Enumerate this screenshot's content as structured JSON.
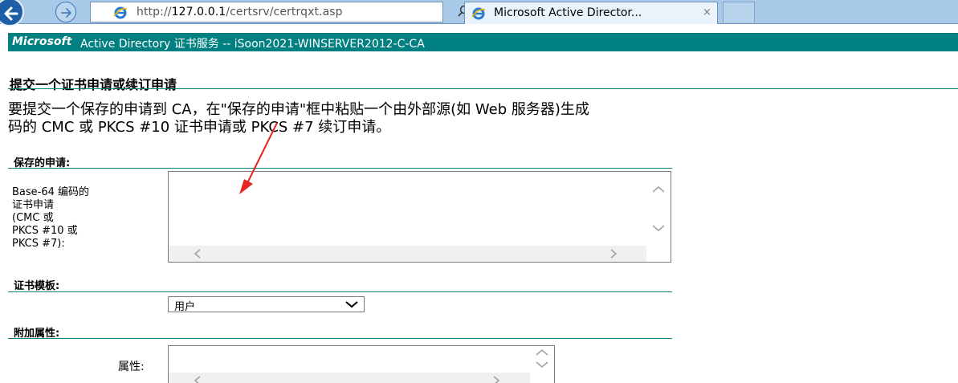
{
  "browser": {
    "url_prefix": "http://",
    "url_host": "127.0.0.1",
    "url_path": "/certsrv/certrqxt.asp",
    "search_icon": "search-icon",
    "refresh_icon": "refresh-icon",
    "tab_title": "Microsoft Active Director...",
    "tab_close": "×"
  },
  "banner": {
    "brand": "Microsoft",
    "text": "Active Directory 证书服务  --  iSoon2021-WINSERVER2012-C-CA"
  },
  "page": {
    "title": "提交一个证书申请或续订申请",
    "intro_line1": "要提交一个保存的申请到 CA，在\"保存的申请\"框中粘贴一个由外部源(如 Web 服务器)生成",
    "intro_line2": "码的 CMC 或 PKCS #10 证书申请或 PKCS #7 续订申请。"
  },
  "saved_request": {
    "heading": "保存的申请:",
    "label_line1": "Base-64 编码的",
    "label_line2": "证书申请",
    "label_line3": "(CMC 或",
    "label_line4": "PKCS #10 或",
    "label_line5": "PKCS #7):",
    "value": ""
  },
  "template": {
    "heading": "证书模板:",
    "selected": "用户"
  },
  "attributes": {
    "heading": "附加属性:",
    "label": "属性:",
    "value": ""
  },
  "colors": {
    "banner_bg": "#008080",
    "rule": "#008080",
    "annotation_arrow": "#e52520"
  }
}
